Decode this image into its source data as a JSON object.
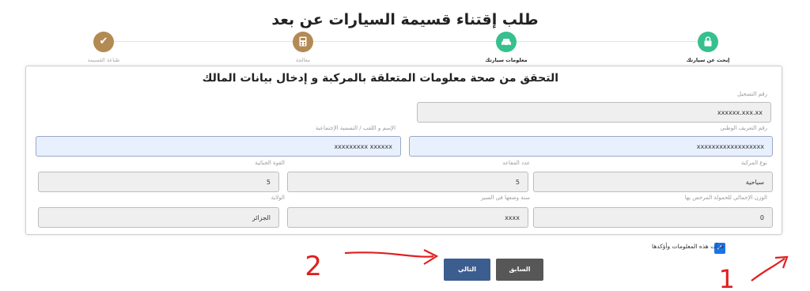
{
  "title": "طلب إقتناء قسيمة السيارات عن بعد",
  "steps": [
    {
      "label": "إبحث عن سيارتك",
      "icon": "lock-icon"
    },
    {
      "label": "معلومات سيارتك",
      "icon": "car-icon"
    },
    {
      "label": "معالجة",
      "icon": "calculator-icon"
    },
    {
      "label": "طباعة القسيمة",
      "icon": "check-icon"
    }
  ],
  "form": {
    "heading": "التحقق من صحة معلومات المتعلقة بالمركبة و إدخال بيانات المالك",
    "registration_label": "رقم التسجيل",
    "registration_value": "xxxxxx.xxx.xx",
    "national_id_label": "رقم التعريف الوطني",
    "national_id_value": "xxxxxxxxxxxxxxxxxx",
    "name_label": "الإسم و اللقب / التسمية الإجتماعية",
    "name_value": "xxxxxxxxx xxxxxx",
    "vehicle_type_label": "نوع المركبة",
    "vehicle_type_value": "سياحية",
    "seats_label": "عدد المقاعد",
    "seats_value": "5",
    "power_label": "القوة الجبائية",
    "power_value": "5",
    "total_weight_label": "الوزن الإجمالي للحمولة المرخص بها",
    "total_weight_value": "0",
    "circulation_label": "سنة وضعها في السير",
    "circulation_value": "xxxx",
    "wilaya_label": "الولاية",
    "wilaya_value": "الجزائر"
  },
  "confirm_label": "قرأت هذه المعلومات وأؤكدها",
  "buttons": {
    "next": "التالي",
    "previous": "السابق"
  },
  "annotations": {
    "one": "1",
    "two": "2"
  },
  "colors": {
    "step_active": "#36c08e",
    "step_pending": "#b38a54",
    "next_button": "#3b5d8f",
    "prev_button": "#575757",
    "annotation": "#e02020"
  }
}
